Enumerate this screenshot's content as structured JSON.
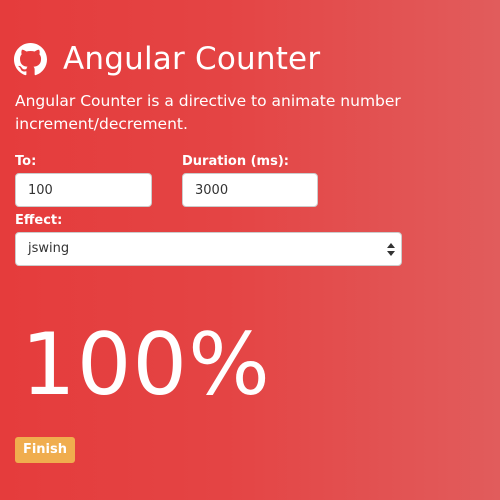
{
  "header": {
    "title": "Angular Counter",
    "icon": "github-icon"
  },
  "description": "Angular Counter is a directive to animate number increment/decrement.",
  "form": {
    "to": {
      "label": "To:",
      "value": "100"
    },
    "duration": {
      "label": "Duration (ms):",
      "value": "3000"
    },
    "effect": {
      "label": "Effect:",
      "selected": "jswing"
    }
  },
  "counter": {
    "display": "100%"
  },
  "status": {
    "label": "Finish",
    "color": "#f0ad4e"
  },
  "colors": {
    "background_start": "#e53c3c",
    "background_end": "#e15c5c",
    "text": "#ffffff"
  }
}
